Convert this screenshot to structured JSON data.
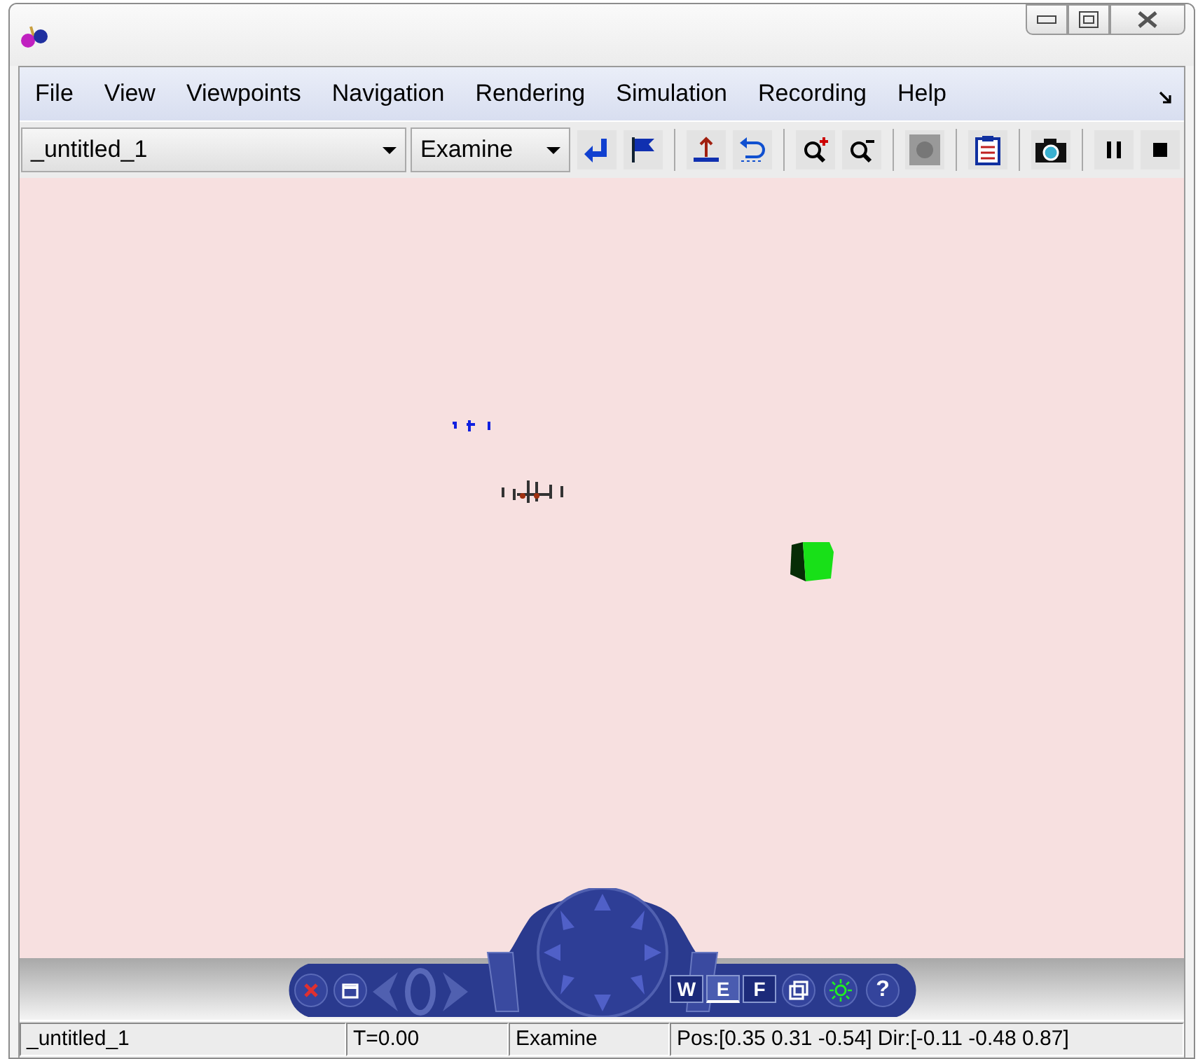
{
  "menu": [
    "File",
    "View",
    "Viewpoints",
    "Navigation",
    "Rendering",
    "Simulation",
    "Recording",
    "Help"
  ],
  "toolbar": {
    "viewpoint": "_untitled_1",
    "mode": "Examine"
  },
  "nav_panel": {
    "modes": [
      {
        "label": "W",
        "selected": false
      },
      {
        "label": "E",
        "selected": true
      },
      {
        "label": "F",
        "selected": false
      }
    ],
    "help": "?"
  },
  "status_bar": [
    "_untitled_1",
    "T=0.00",
    "Examine",
    "Pos:[0.35 0.31 -0.54] Dir:[-0.11 -0.48 0.87]"
  ]
}
